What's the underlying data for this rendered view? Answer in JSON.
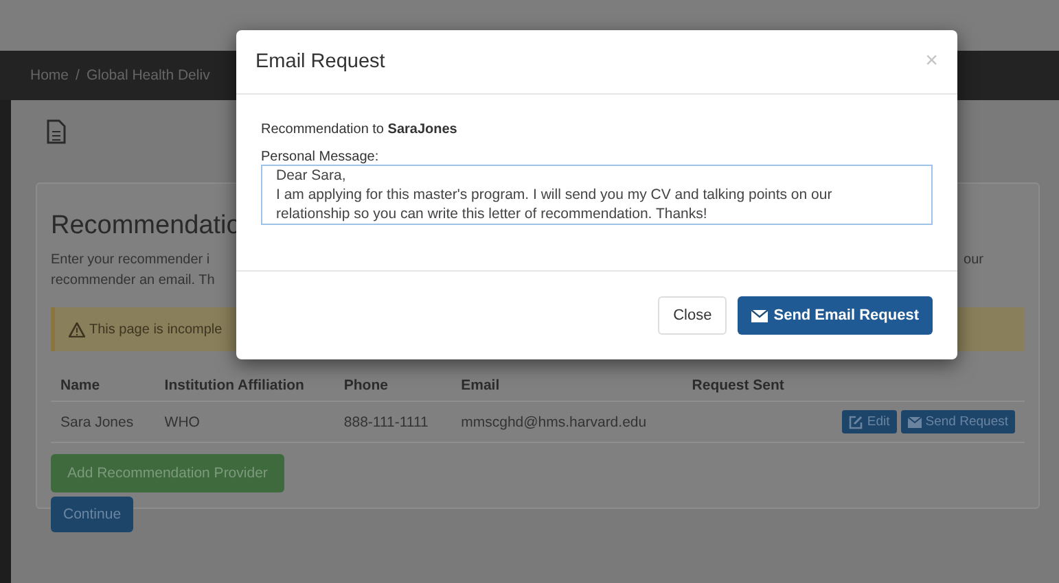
{
  "breadcrumb": [
    "Home",
    "Global Health Deliv"
  ],
  "breadcrumb_separator": "/",
  "section": {
    "heading": "Recommendatio",
    "intro_lines": [
      "Enter your recommender i",
      "recommender an email. Th"
    ],
    "intro_tail": "our",
    "alert": "This page is incomple",
    "table": {
      "columns": [
        "Name",
        "Institution Affiliation",
        "Phone",
        "Email",
        "Request Sent"
      ],
      "rows": [
        {
          "name": "Sara Jones",
          "institution": "WHO",
          "phone": "888-111-1111",
          "email": "mmscghd@hms.harvard.edu",
          "actions": [
            "Edit",
            "Send Request"
          ]
        }
      ]
    },
    "buttons": [
      "Add Recommendation Provider",
      "Continue"
    ]
  },
  "modal": {
    "title": "Email Request",
    "close": "×",
    "recipient": "Recommendation to **SaraJones**",
    "message_label": "Personal Message:",
    "message": "Dear Sara,\nI am applying for this master's program. I will send you my CV and talking points on our relationship so you can write this letter of recommendation. Thanks!",
    "buttons": [
      "Close",
      "Send Email Request"
    ]
  }
}
